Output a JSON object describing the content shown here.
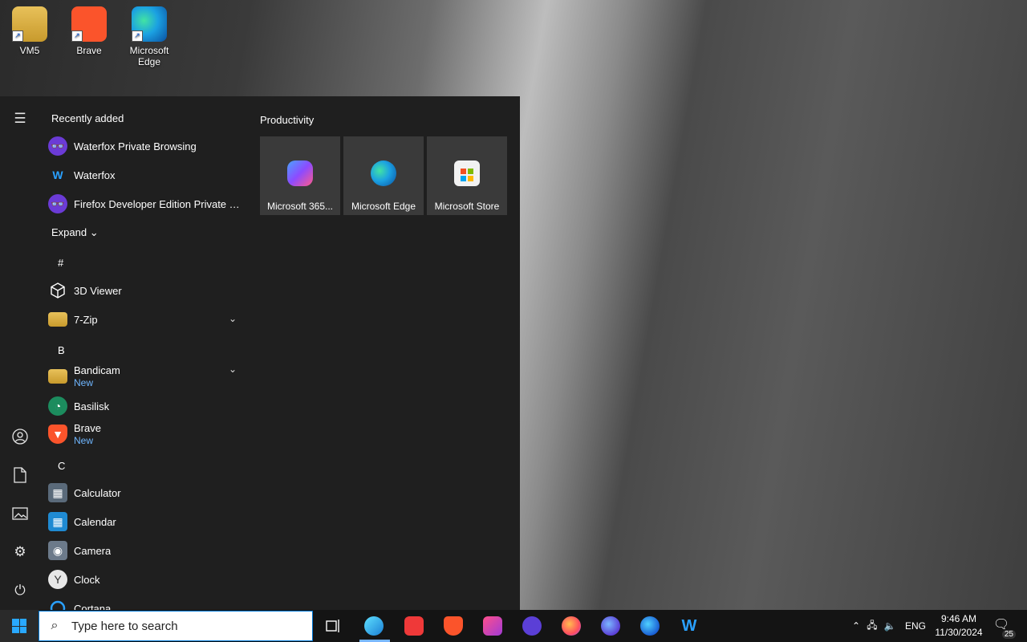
{
  "desktop": {
    "icons": [
      {
        "label": "VM5"
      },
      {
        "label": "Brave"
      },
      {
        "label": "Microsoft Edge"
      }
    ]
  },
  "start_menu": {
    "recently_added_title": "Recently added",
    "recent": [
      {
        "label": "Waterfox Private Browsing",
        "icon": "waterfox-private-icon",
        "color": "#6b3bd6"
      },
      {
        "label": "Waterfox",
        "icon": "waterfox-icon",
        "color": "#2aa1ff"
      },
      {
        "label": "Firefox Developer Edition Private Bro...",
        "icon": "firefox-private-icon",
        "color": "#6b3bd6"
      }
    ],
    "expand_label": "Expand",
    "letters": {
      "hash": "#",
      "b": "B",
      "c": "C"
    },
    "apps": [
      {
        "label": "3D Viewer",
        "icon": "cube-icon"
      },
      {
        "label": "7-Zip",
        "icon": "folder-icon",
        "expandable": true
      },
      {
        "label": "Bandicam",
        "sub": "New",
        "icon": "folder-icon",
        "expandable": true
      },
      {
        "label": "Basilisk",
        "icon": "basilisk-icon"
      },
      {
        "label": "Brave",
        "sub": "New",
        "icon": "brave-icon"
      },
      {
        "label": "Calculator",
        "icon": "calculator-icon"
      },
      {
        "label": "Calendar",
        "icon": "calendar-icon"
      },
      {
        "label": "Camera",
        "icon": "camera-icon"
      },
      {
        "label": "Clock",
        "icon": "clock-icon"
      },
      {
        "label": "Cortana",
        "icon": "cortana-icon"
      }
    ],
    "group_title": "Productivity",
    "tiles": [
      {
        "label": "Microsoft 365...",
        "icon": "microsoft-365-icon"
      },
      {
        "label": "Microsoft Edge",
        "icon": "edge-icon"
      },
      {
        "label": "Microsoft Store",
        "icon": "store-icon"
      }
    ]
  },
  "taskbar": {
    "search_placeholder": "Type here to search",
    "language": "ENG",
    "time": "9:46 AM",
    "date": "11/30/2024",
    "notification_count": "25",
    "accent": "#0078d7"
  }
}
